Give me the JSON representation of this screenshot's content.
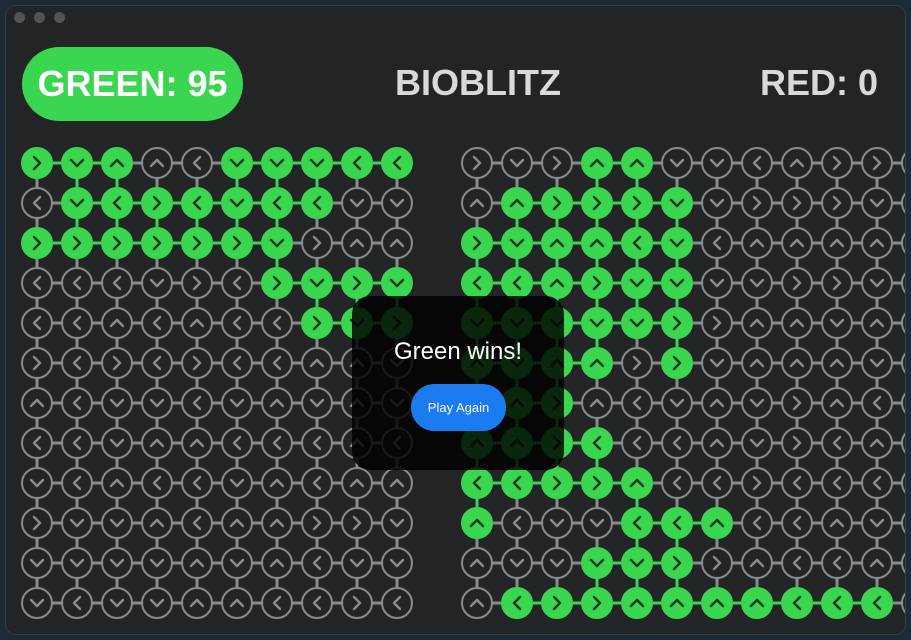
{
  "app": {
    "title": "BIOBLITZ"
  },
  "score": {
    "green": "GREEN: 95",
    "red": "RED: 0"
  },
  "colors": {
    "green": "#3bd64f",
    "gray": "#8a8b8e",
    "background": "#232426",
    "button": "#1a7cf0"
  },
  "board": {
    "rows": [
      "RDUULDDDLL|RDRUUDDLURRDUR|",
      "LDLRLDLLDD|UURRRDDRRRDURU|",
      "RRRRRRDRUU|RDUULDLUUUUULL|",
      "LLLDRLRDRD|LLURDDDDRRDDRL|",
      "LLULULLRDR|DDDDDRRUUDUDUR|",
      "RLRLRLLUUD|UDUURRDUUUDDUR|",
      "ULDDLDUDUD|DURULDUDRULDUR|",
      "LLDUULLLUL|UURLLLUDRLUDUU|",
      "DLULLDULUU|LLRRULLRLLLDLL|",
      "RDDULUURRD|ULDDLLULLUDURU|",
      "DDDDUDULDD|UDDDDRRULLURLL|",
      "DLDDUULLRL|ULRRUUUULLLLLL|"
    ],
    "owners": [
      "GGGEEGGGGGEEEEGGEEEEEE",
      "EGGGGGGGEEEEGGGGGEEEEE",
      "GGGGGGGEEEGGGGGGGEEEEE",
      "EEEEEEGGGGGGGGGGGEEEEE",
      "EEEEEEEGGGGGGGGGGEEEEE",
      "EEEEEEEEEEEGGGGEGEEEEE",
      "EEEEEEEEEEEGGGEEEEEEEE",
      "EEEEEEEEEEEGGGGEEEEEEE",
      "EEEEEEEEEEGGGGGGEEEEEE",
      "EEEEEEEEEEGGEEEGGGEEEE",
      "EEEEEEEEEEEEEEGGGEEEEE",
      "EEEEEEEEEEEEGGGGGGGGGG"
    ]
  },
  "overlay": {
    "message": "Green wins!",
    "button_label": "Play Again"
  }
}
